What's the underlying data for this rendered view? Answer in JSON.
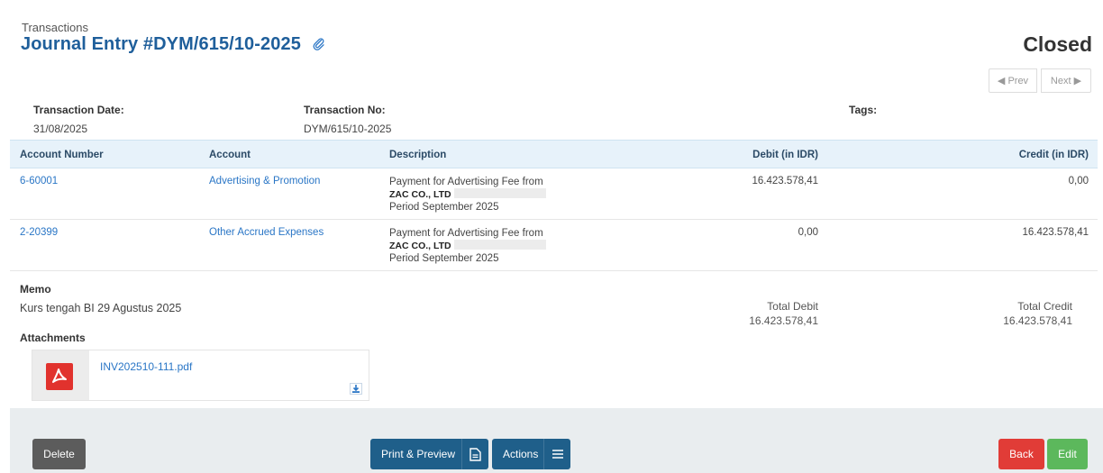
{
  "header": {
    "breadcrumb": "Transactions",
    "title": "Journal Entry #DYM/615/10-2025",
    "status": "Closed",
    "prev_label": "◀ Prev",
    "next_label": "Next ▶"
  },
  "meta": {
    "date_label": "Transaction Date:",
    "date_value": "31/08/2025",
    "number_label": "Transaction No:",
    "number_value": "DYM/615/10-2025",
    "tags_label": "Tags:"
  },
  "table": {
    "columns": [
      "Account Number",
      "Account",
      "Description",
      "Debit (in IDR)",
      "Credit (in IDR)"
    ],
    "rows": [
      {
        "account_number": "6-60001",
        "account": "Advertising & Promotion",
        "desc_line1": "Payment for Advertising Fee from",
        "desc_line2": "ZAC CO., LTD",
        "desc_line3": "Period September 2025",
        "debit": "16.423.578,41",
        "credit": "0,00"
      },
      {
        "account_number": "2-20399",
        "account": "Other Accrued Expenses",
        "desc_line1": "Payment for Advertising Fee from",
        "desc_line2": "ZAC CO., LTD",
        "desc_line3": "Period September 2025",
        "debit": "0,00",
        "credit": "16.423.578,41"
      }
    ]
  },
  "memo": {
    "label": "Memo",
    "value": "Kurs tengah BI 29 Agustus 2025"
  },
  "totals": {
    "debit_label": "Total Debit",
    "debit_value": "16.423.578,41",
    "credit_label": "Total Credit",
    "credit_value": "16.423.578,41"
  },
  "attachments": {
    "label": "Attachments",
    "file_name": "INV202510-111.pdf"
  },
  "footer": {
    "delete_label": "Delete",
    "print_label": "Print & Preview",
    "actions_label": "Actions",
    "back_label": "Back",
    "edit_label": "Edit"
  },
  "colors": {
    "title_blue": "#1f5f9b",
    "link_blue": "#2a76c6",
    "header_bg": "#e7f2fa",
    "delete_gray": "#5c5c5c",
    "print_blue": "#1f5f8a",
    "back_red": "#e13c37",
    "edit_green": "#5cb85c",
    "pdf_red": "#e1322d"
  },
  "icons": {
    "title": "paperclip-icon",
    "print": "document-icon",
    "actions": "hamburger-menu-icon",
    "attachment": "pdf-icon",
    "download": "download-icon"
  }
}
